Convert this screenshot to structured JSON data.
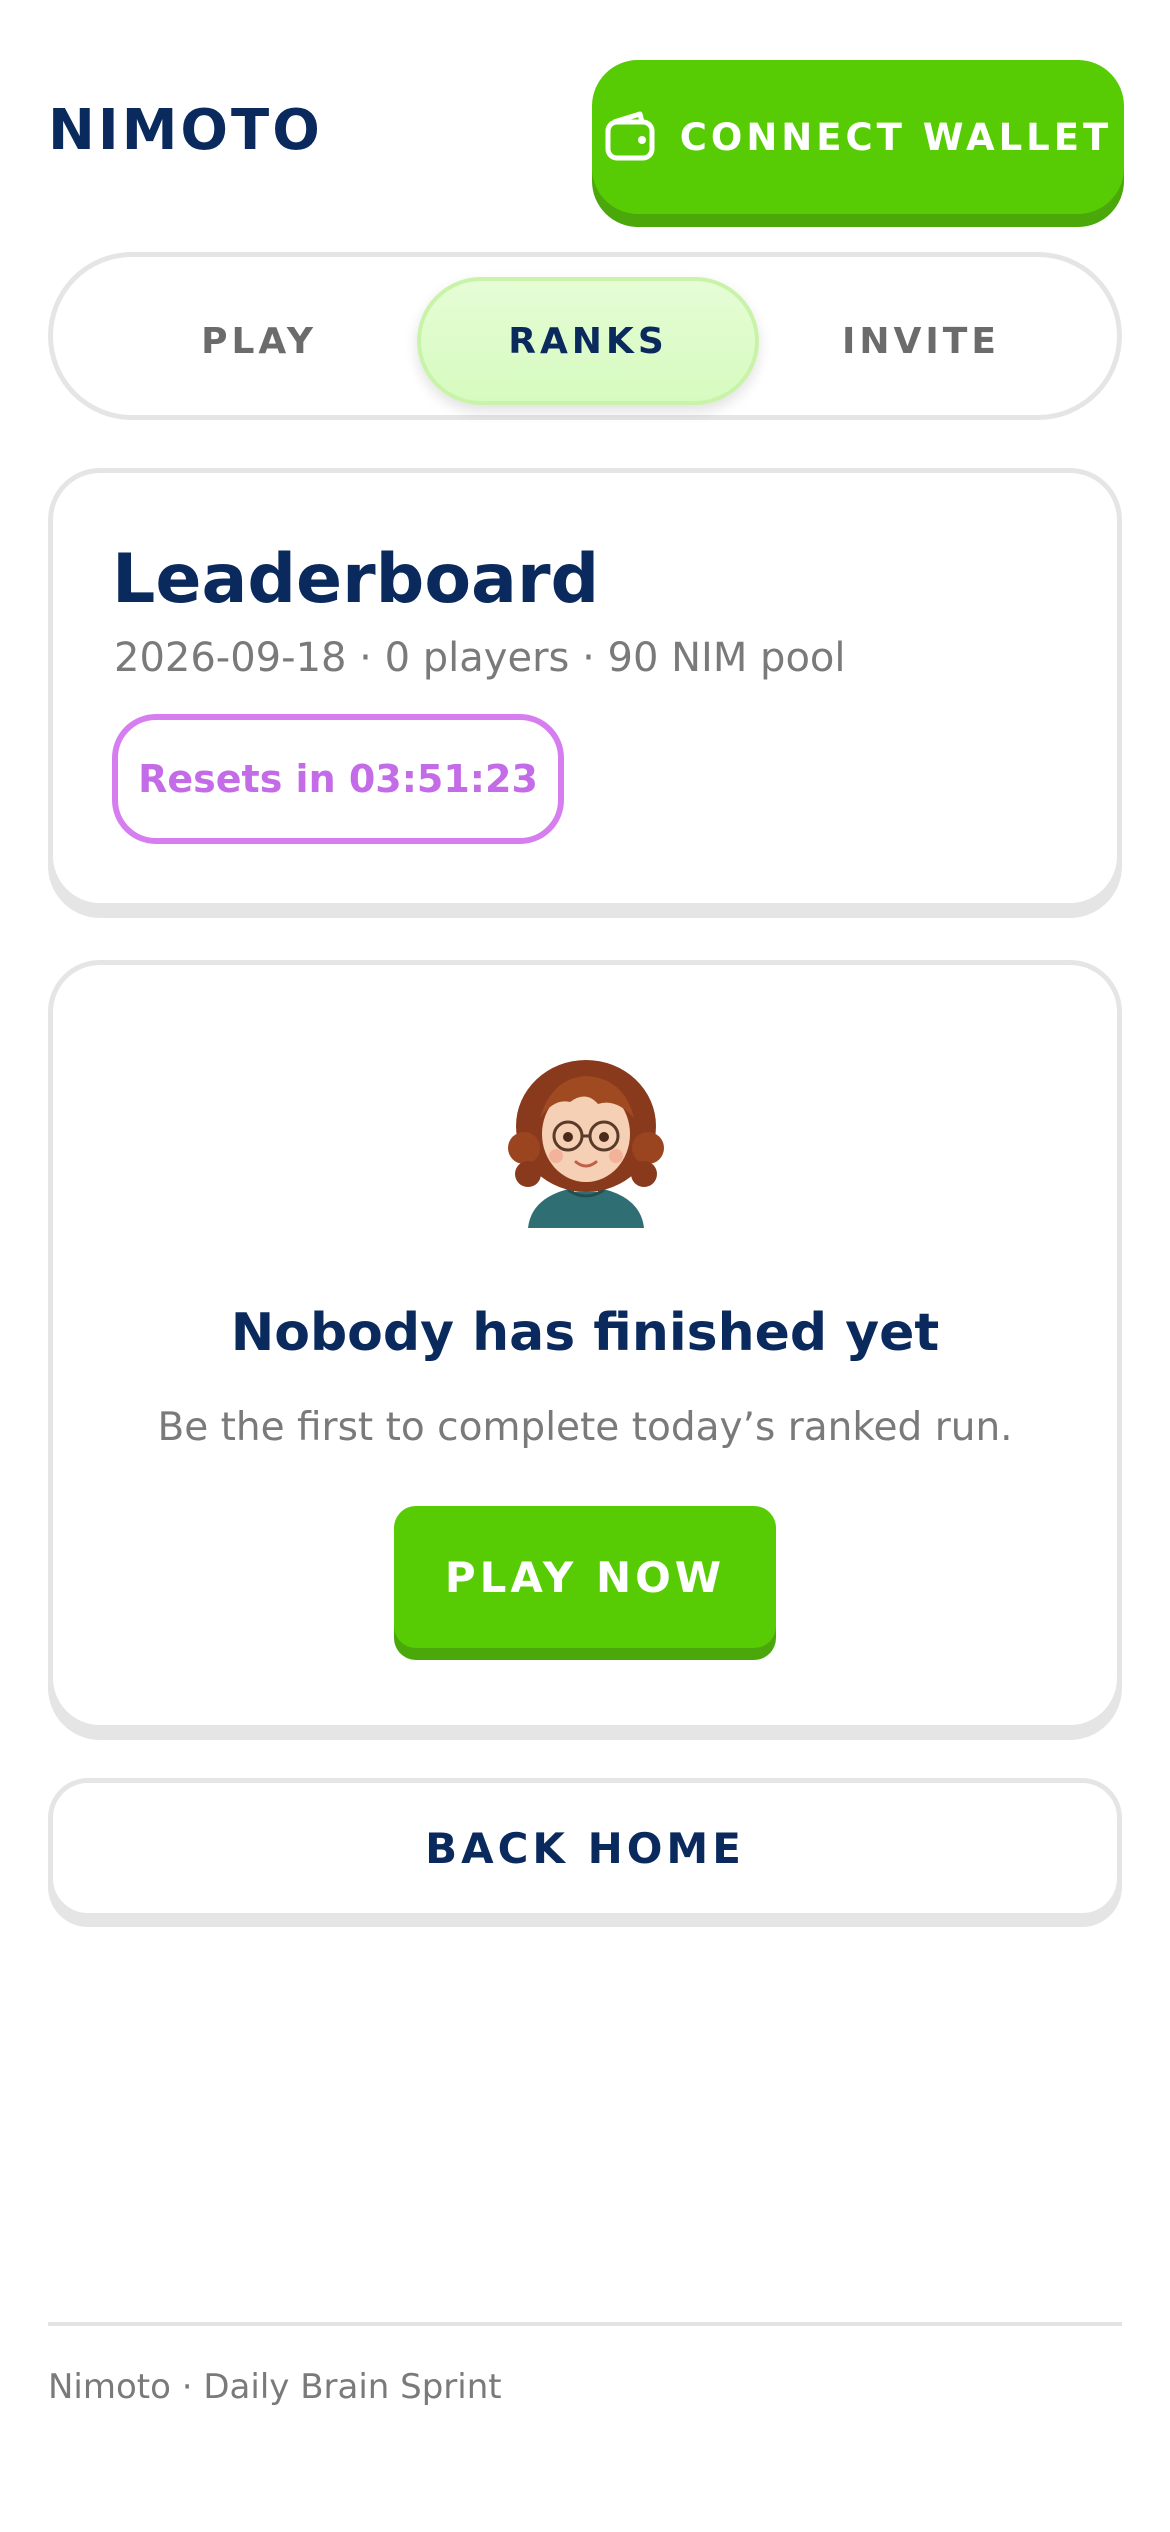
{
  "header": {
    "brand": "NIMOTO",
    "connect_wallet_label": "CONNECT WALLET",
    "wallet_icon": "wallet-icon"
  },
  "tabs": [
    {
      "label": "PLAY",
      "active": false
    },
    {
      "label": "RANKS",
      "active": true
    },
    {
      "label": "INVITE",
      "active": false
    }
  ],
  "leaderboard": {
    "title": "Leaderboard",
    "meta": "2026-09-18 · 0 players · 90 NIM pool",
    "reset_label": "Resets in 03:51:23"
  },
  "empty_state": {
    "avatar": "avatar-illustration",
    "title": "Nobody has finished yet",
    "subtitle": "Be the first to complete today’s ranked run.",
    "play_now_label": "PLAY NOW"
  },
  "back_home_label": "BACK HOME",
  "footer": {
    "text": "Nimoto · Daily Brain Sprint"
  },
  "colors": {
    "accent_green": "#57cc04",
    "navy": "#0a2a5e",
    "pill_purple": "#c46ce8",
    "active_tab_bg": "#d6fbbf"
  }
}
